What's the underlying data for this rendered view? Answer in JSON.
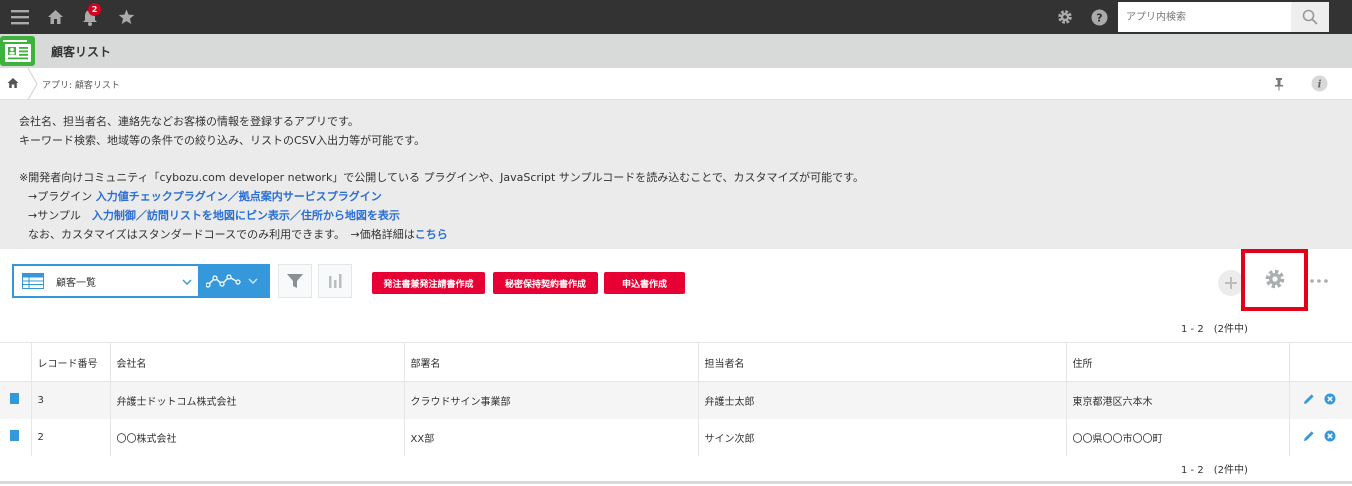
{
  "topbar": {
    "notification_count": "2",
    "search_placeholder": "アプリ内検索"
  },
  "app": {
    "title": "顧客リスト",
    "breadcrumb": "アプリ: 顧客リスト"
  },
  "description": {
    "line1": "会社名、担当者名、連絡先などお客様の情報を登録するアプリです。",
    "line2": "キーワード検索、地域等の条件での絞り込み、リストのCSV入出力等が可能です。",
    "line3": "※開発者向けコミュニティ「cybozu.com developer network」で公開している プラグインや、JavaScript サンプルコードを読み込むことで、カスタマイズが可能です。",
    "plugin_prefix": "→プラグイン ",
    "plugin_link1": "入力値チェックプラグイン",
    "slash": "／",
    "plugin_link2": "拠点案内サービスプラグイン",
    "sample_prefix": "→サンプル　",
    "sample_link1": "入力制御",
    "sample_link2": "訪問リストを地図にピン表示",
    "sample_link3": "住所から地図を表示",
    "note_prefix": "なお、カスタマイズはスタンダードコースでのみ利用できます。　→価格詳細は",
    "note_link": "こちら"
  },
  "toolbar": {
    "view_label": "顧客一覧",
    "buttons": [
      "発注書兼発注請書作成",
      "秘密保持契約書作成",
      "申込書作成"
    ]
  },
  "pager": "1 - 2　(2件中)",
  "table": {
    "headers": [
      "レコード番号",
      "会社名",
      "部署名",
      "担当者名",
      "住所"
    ],
    "rows": [
      {
        "id": "3",
        "company": "弁護士ドットコム株式会社",
        "department": "クラウドサイン事業部",
        "person": "弁護士太郎",
        "address": "東京都港区六本木"
      },
      {
        "id": "2",
        "company": "〇〇株式会社",
        "department": "XX部",
        "person": "サイン次郎",
        "address": "〇〇県〇〇市〇〇町"
      }
    ]
  },
  "colors": {
    "accent": "#3498db",
    "red": "#e60033",
    "topbar": "#333333",
    "highlight_frame": "#e5001a"
  }
}
